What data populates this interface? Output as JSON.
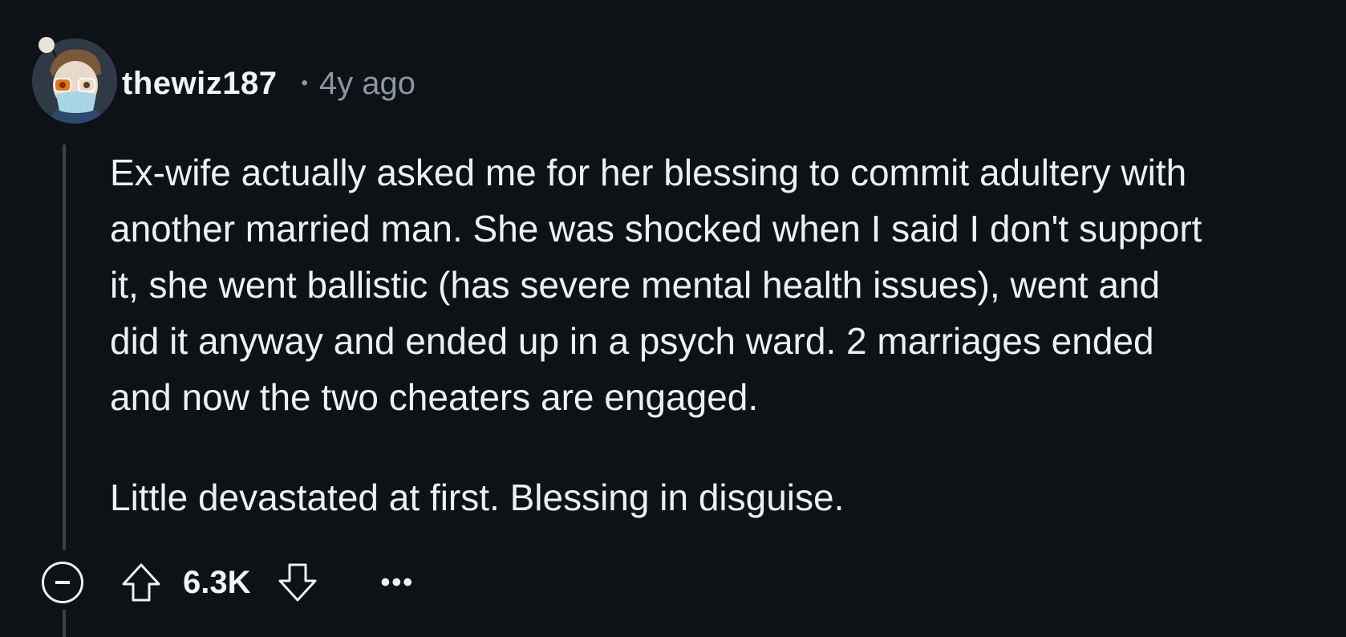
{
  "comment": {
    "username": "thewiz187",
    "separator": "•",
    "timestamp": "4y ago",
    "paragraphs": [
      "Ex-wife actually asked me for her blessing to commit adultery with\nanother married man. She was shocked when I said I don't support\nit, she went ballistic (has severe mental health issues), went and\ndid it anyway and ended up in a psych ward. 2 marriages ended\nand now the two cheaters are engaged.",
      "Little devastated at first. Blessing in disguise."
    ],
    "score": "6.3K",
    "more_label": "•••"
  },
  "icons": {
    "avatar": "user-avatar",
    "collapse": "collapse-minus-icon",
    "upvote": "upvote-arrow-icon",
    "downvote": "downvote-arrow-icon",
    "more": "more-options-icon"
  },
  "colors": {
    "background": "#0e1116",
    "text": "#eef1f3",
    "muted": "#8a97a3",
    "thread_line": "#3a434c"
  }
}
